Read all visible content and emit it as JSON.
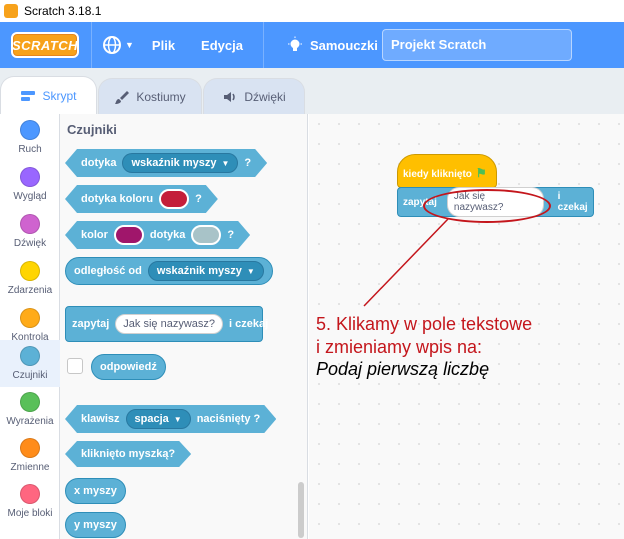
{
  "window": {
    "title": "Scratch 3.18.1"
  },
  "menubar": {
    "logo": "SCRATCH",
    "file": "Plik",
    "edit": "Edycja",
    "tutorials": "Samouczki",
    "project_title": "Projekt Scratch"
  },
  "tabs": [
    {
      "label": "Skrypt",
      "active": true
    },
    {
      "label": "Kostiumy",
      "active": false
    },
    {
      "label": "Dźwięki",
      "active": false
    }
  ],
  "categories": [
    {
      "label": "Ruch",
      "color": "#4c97ff"
    },
    {
      "label": "Wygląd",
      "color": "#9966ff"
    },
    {
      "label": "Dźwięk",
      "color": "#cf63cf"
    },
    {
      "label": "Zdarzenia",
      "color": "#ffd500"
    },
    {
      "label": "Kontrola",
      "color": "#ffab19"
    },
    {
      "label": "Czujniki",
      "color": "#5cb1d6",
      "active": true
    },
    {
      "label": "Wyrażenia",
      "color": "#59c059"
    },
    {
      "label": "Zmienne",
      "color": "#ff8c1a"
    },
    {
      "label": "Moje bloki",
      "color": "#ff6680"
    }
  ],
  "palette": {
    "title": "Czujniki",
    "touching": {
      "text": "dotyka",
      "dropdown": "wskaźnik myszy",
      "tail": "?"
    },
    "touching_color": {
      "text": "dotyka koloru",
      "color": "#c41e3a",
      "tail": "?"
    },
    "color_touching": {
      "text1": "kolor",
      "color1": "#a0166b",
      "text2": "dotyka",
      "color2": "#a8c3c8",
      "tail": "?"
    },
    "distance": {
      "text": "odległość od",
      "dropdown": "wskaźnik myszy"
    },
    "ask": {
      "text": "zapytaj",
      "input": "Jak się nazywasz?",
      "tail": "i czekaj"
    },
    "answer": {
      "text": "odpowiedź"
    },
    "key_pressed": {
      "text": "klawisz",
      "dropdown": "spacja",
      "tail": "naciśnięty ?"
    },
    "mouse_down": {
      "text": "kliknięto myszką?"
    },
    "mouse_x": {
      "text": "x myszy"
    },
    "mouse_y": {
      "text": "y myszy"
    }
  },
  "script": {
    "hat": "kiedy kliknięto",
    "ask_text": "zapytaj",
    "ask_input": "Jak się nazywasz?",
    "ask_tail": "i czekaj"
  },
  "annotation": {
    "line1": "5. Klikamy w pole tekstowe",
    "line2": "i zmieniamy wpis na:",
    "line3": "Podaj pierwszą liczbę",
    "color": "#c4161c"
  }
}
